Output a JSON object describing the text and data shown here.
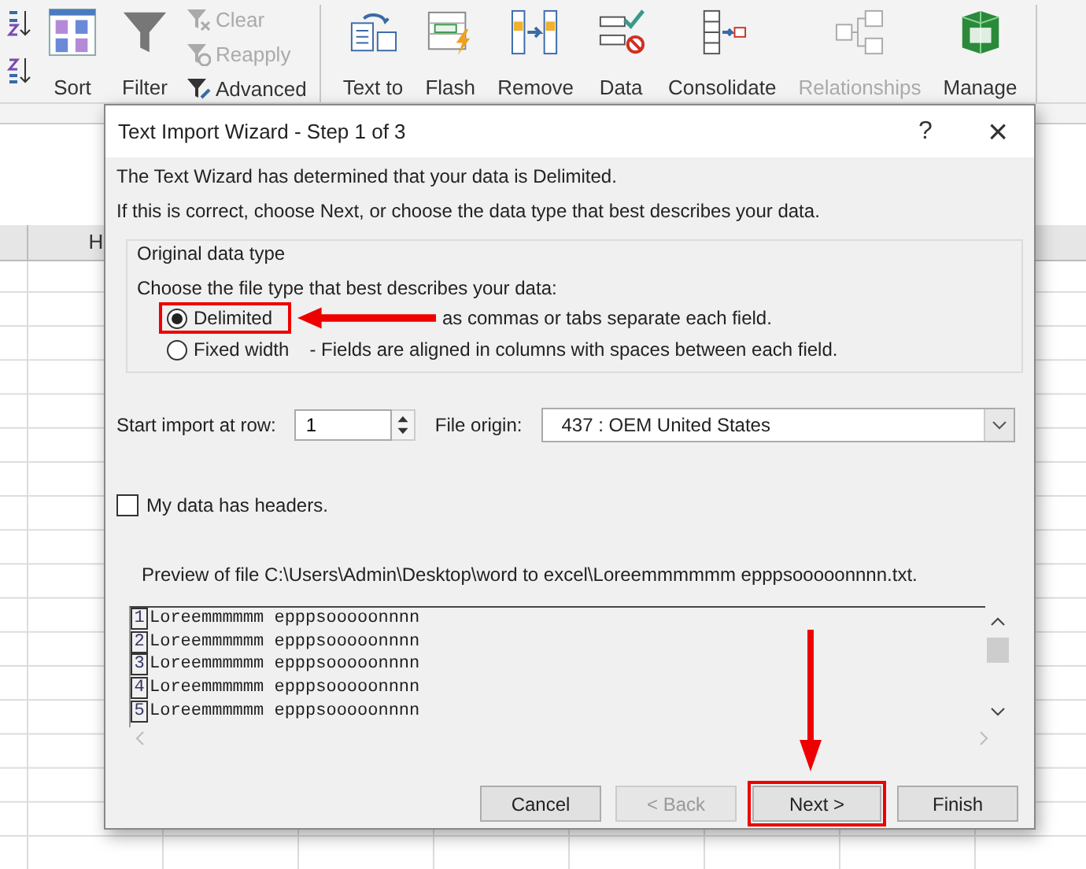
{
  "ribbon": {
    "groups": [
      {
        "items": [
          {
            "kind": "sort-pair"
          },
          {
            "kind": "large",
            "label": "Sort",
            "disabled": false
          },
          {
            "kind": "large",
            "label": "Filter",
            "disabled": false
          },
          {
            "kind": "small-stack",
            "entries": [
              {
                "label": "Clear",
                "disabled": true
              },
              {
                "label": "Reapply",
                "disabled": true
              },
              {
                "label": "Advanced",
                "disabled": false
              }
            ]
          }
        ]
      },
      {
        "items": [
          {
            "kind": "large",
            "label": "Text to",
            "disabled": false
          },
          {
            "kind": "large",
            "label": "Flash",
            "disabled": false
          },
          {
            "kind": "large",
            "label": "Remove",
            "disabled": false
          },
          {
            "kind": "large",
            "label": "Data",
            "disabled": false
          },
          {
            "kind": "large",
            "label": "Consolidate",
            "disabled": false
          },
          {
            "kind": "large",
            "label": "Relationships",
            "disabled": true
          },
          {
            "kind": "large",
            "label": "Manage",
            "disabled": false
          }
        ]
      }
    ]
  },
  "sheet": {
    "column_header": "H"
  },
  "dialog": {
    "title": "Text Import Wizard - Step 1 of 3",
    "help": "?",
    "close": "×",
    "intro": [
      "The Text Wizard has determined that your data is Delimited.",
      "If this is correct, choose Next, or choose the data type that best describes your data."
    ],
    "group": {
      "title": "Original data type",
      "prompt": "Choose the file type that best describes your data:",
      "options": [
        {
          "label": "Delimited",
          "description": "as commas or tabs separate each field.",
          "selected": true,
          "callout": true
        },
        {
          "label": "Fixed width",
          "description": "- Fields are aligned in columns with spaces between each field.",
          "selected": false,
          "callout": false
        }
      ]
    },
    "start_row": {
      "label": "Start import at row:",
      "value": "1"
    },
    "file_origin": {
      "label": "File origin:",
      "value": "437 : OEM United States"
    },
    "headers_checkbox": {
      "label": "My data has headers.",
      "checked": false
    },
    "preview": {
      "label": "Preview of file C:\\Users\\Admin\\Desktop\\word to excel\\Loreemmmmmm epppsooooonnnn.txt.",
      "lines": [
        {
          "number": "1",
          "text": "Loreemmmmmm epppsooooonnnn"
        },
        {
          "number": "2",
          "text": "Loreemmmmmm epppsooooonnnn"
        },
        {
          "number": "3",
          "text": "Loreemmmmmm epppsooooonnnn"
        },
        {
          "number": "4",
          "text": "Loreemmmmmm epppsooooonnnn"
        },
        {
          "number": "5",
          "text": "Loreemmmmmm epppsooooonnnn"
        }
      ]
    },
    "buttons": [
      {
        "label": "Cancel",
        "disabled": false,
        "callout": false
      },
      {
        "label": "< Back",
        "disabled": true,
        "callout": false
      },
      {
        "label": "Next >",
        "disabled": false,
        "callout": true
      },
      {
        "label": "Finish",
        "disabled": false,
        "callout": false
      }
    ]
  }
}
